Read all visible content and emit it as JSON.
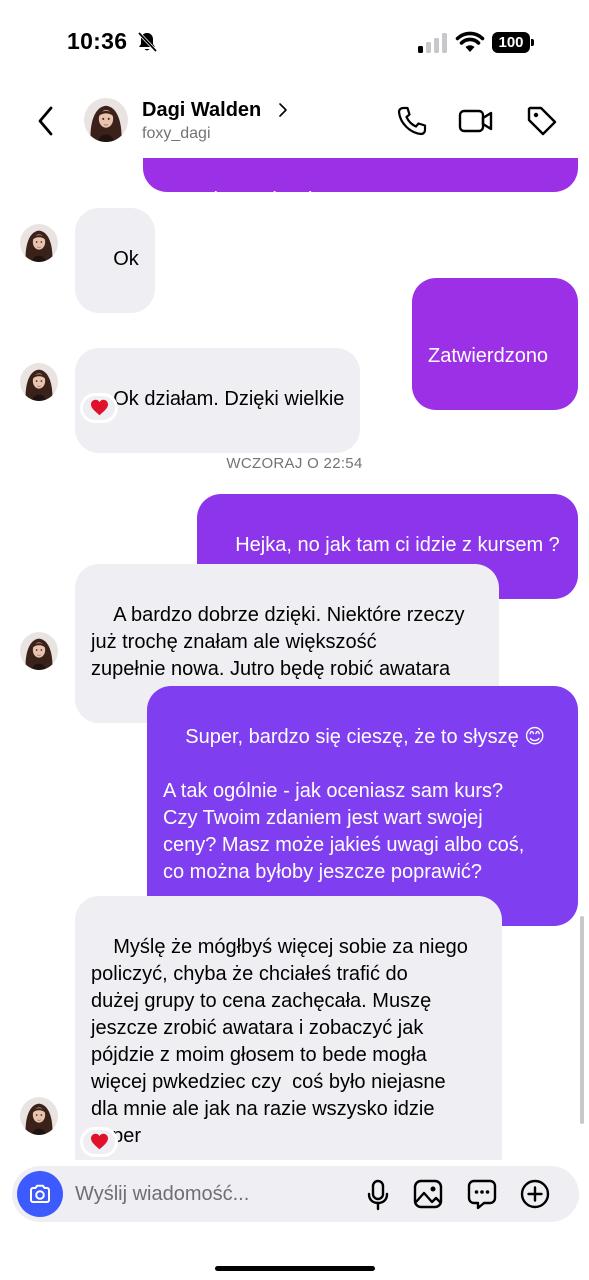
{
  "status_bar": {
    "time": "10:36",
    "battery": "100"
  },
  "header": {
    "name": "Dagi Walden",
    "handle": "foxy_dagi"
  },
  "colors": {
    "outgoing_purple": "#9b30e6",
    "outgoing_violet": "#7f3ff0",
    "incoming_bg": "#efeff3",
    "camera_blue": "#3d5afe"
  },
  "messages": [
    {
      "from": "me",
      "text": "zaakceptuję Cię."
    },
    {
      "from": "them",
      "text": "Ok"
    },
    {
      "from": "me",
      "text": "Zatwierdzono"
    },
    {
      "from": "them",
      "text": "Ok działam. Dzięki wielkie",
      "reaction": "heart"
    },
    {
      "from": "me",
      "text": "Hejka, no jak tam ci idzie z kursem ?"
    },
    {
      "from": "them",
      "text": "A bardzo dobrze dzięki. Niektóre rzeczy\njuż trochę znałam ale większość\nzupełnie nowa. Jutro będę robić awatara"
    },
    {
      "from": "me",
      "text": "Super, bardzo się cieszę, że to słyszę 😊\n\nA tak ogólnie - jak oceniasz sam kurs?\nCzy Twoim zdaniem jest wart swojej\nceny? Masz może jakieś uwagi albo coś,\nco można byłoby jeszcze poprawić?"
    },
    {
      "from": "them",
      "text": "Myślę że mógłbyś więcej sobie za niego\npoliczyć, chyba że chciałeś trafić do\ndużej grupy to cena zachęcała. Muszę\njeszcze zrobić awatara i zobaczyć jak\npójdzie z moim głosem to bede mogła\nwięcej pwkedziec czy  coś było niejasne\ndla mnie ale jak na razie wszysko idzie\nsuper",
      "reaction": "heart"
    }
  ],
  "divider": "WCZORAJ O 22:54",
  "composer": {
    "placeholder": "Wyślij wiadomość..."
  }
}
